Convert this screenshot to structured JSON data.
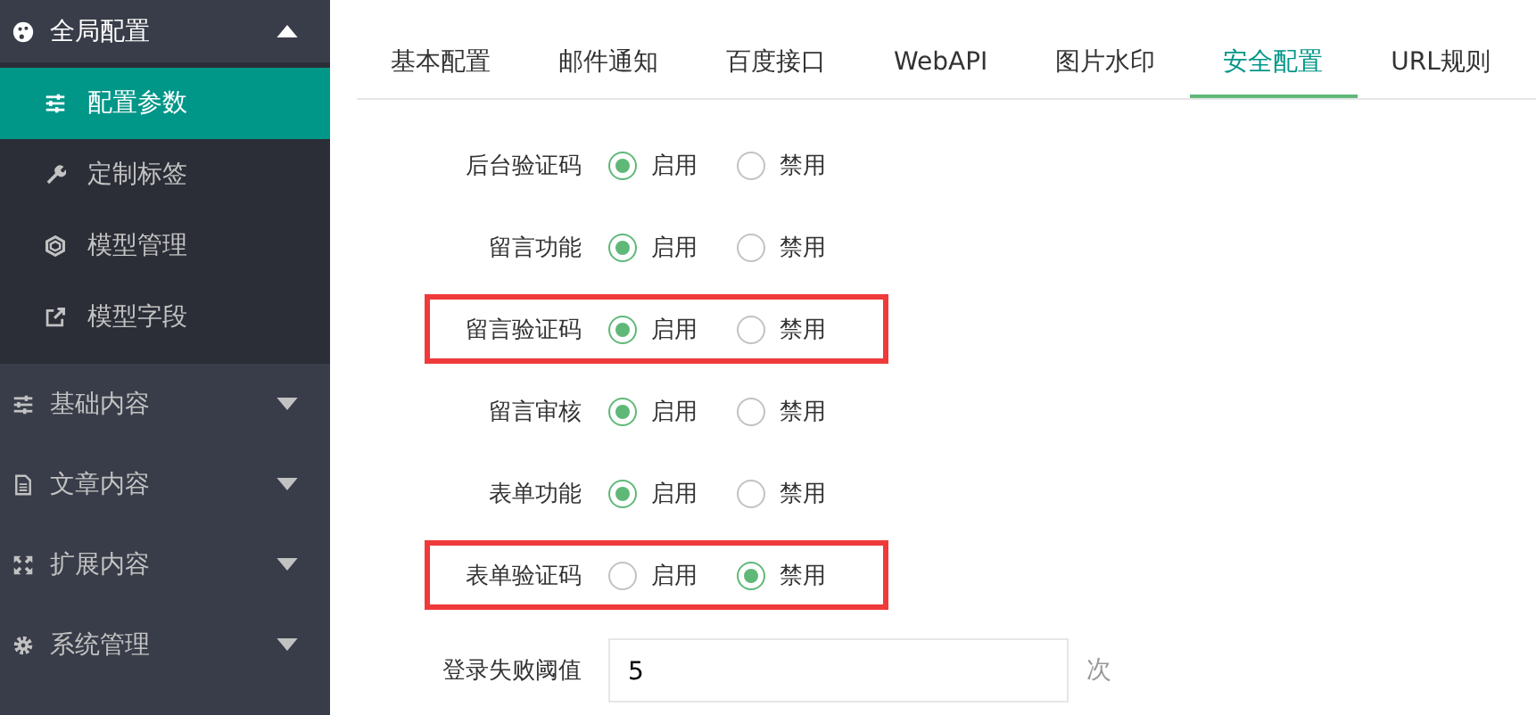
{
  "sidebar": {
    "groups": [
      {
        "label": "全局配置",
        "expanded": true,
        "children": [
          {
            "label": "配置参数",
            "selected": true
          },
          {
            "label": "定制标签",
            "selected": false
          },
          {
            "label": "模型管理",
            "selected": false
          },
          {
            "label": "模型字段",
            "selected": false
          }
        ]
      },
      {
        "label": "基础内容",
        "expanded": false
      },
      {
        "label": "文章内容",
        "expanded": false
      },
      {
        "label": "扩展内容",
        "expanded": false
      },
      {
        "label": "系统管理",
        "expanded": false
      }
    ]
  },
  "tabs": [
    {
      "label": "基本配置",
      "selected": false
    },
    {
      "label": "邮件通知",
      "selected": false
    },
    {
      "label": "百度接口",
      "selected": false
    },
    {
      "label": "WebAPI",
      "selected": false
    },
    {
      "label": "图片水印",
      "selected": false
    },
    {
      "label": "安全配置",
      "selected": true
    },
    {
      "label": "URL规则",
      "selected": false
    }
  ],
  "settings": [
    {
      "kind": "radio",
      "label": "后台验证码",
      "highlighted": false,
      "options": [
        {
          "label": "启用",
          "selected": true
        },
        {
          "label": "禁用",
          "selected": false
        }
      ]
    },
    {
      "kind": "radio",
      "label": "留言功能",
      "highlighted": false,
      "options": [
        {
          "label": "启用",
          "selected": true
        },
        {
          "label": "禁用",
          "selected": false
        }
      ]
    },
    {
      "kind": "radio",
      "label": "留言验证码",
      "highlighted": true,
      "options": [
        {
          "label": "启用",
          "selected": true
        },
        {
          "label": "禁用",
          "selected": false
        }
      ]
    },
    {
      "kind": "radio",
      "label": "留言审核",
      "highlighted": false,
      "options": [
        {
          "label": "启用",
          "selected": true
        },
        {
          "label": "禁用",
          "selected": false
        }
      ]
    },
    {
      "kind": "radio",
      "label": "表单功能",
      "highlighted": false,
      "options": [
        {
          "label": "启用",
          "selected": true
        },
        {
          "label": "禁用",
          "selected": false
        }
      ]
    },
    {
      "kind": "radio",
      "label": "表单验证码",
      "highlighted": true,
      "options": [
        {
          "label": "启用",
          "selected": false
        },
        {
          "label": "禁用",
          "selected": true
        }
      ]
    },
    {
      "kind": "input",
      "label": "登录失败阈值",
      "value": "5",
      "unit": "次"
    }
  ]
}
